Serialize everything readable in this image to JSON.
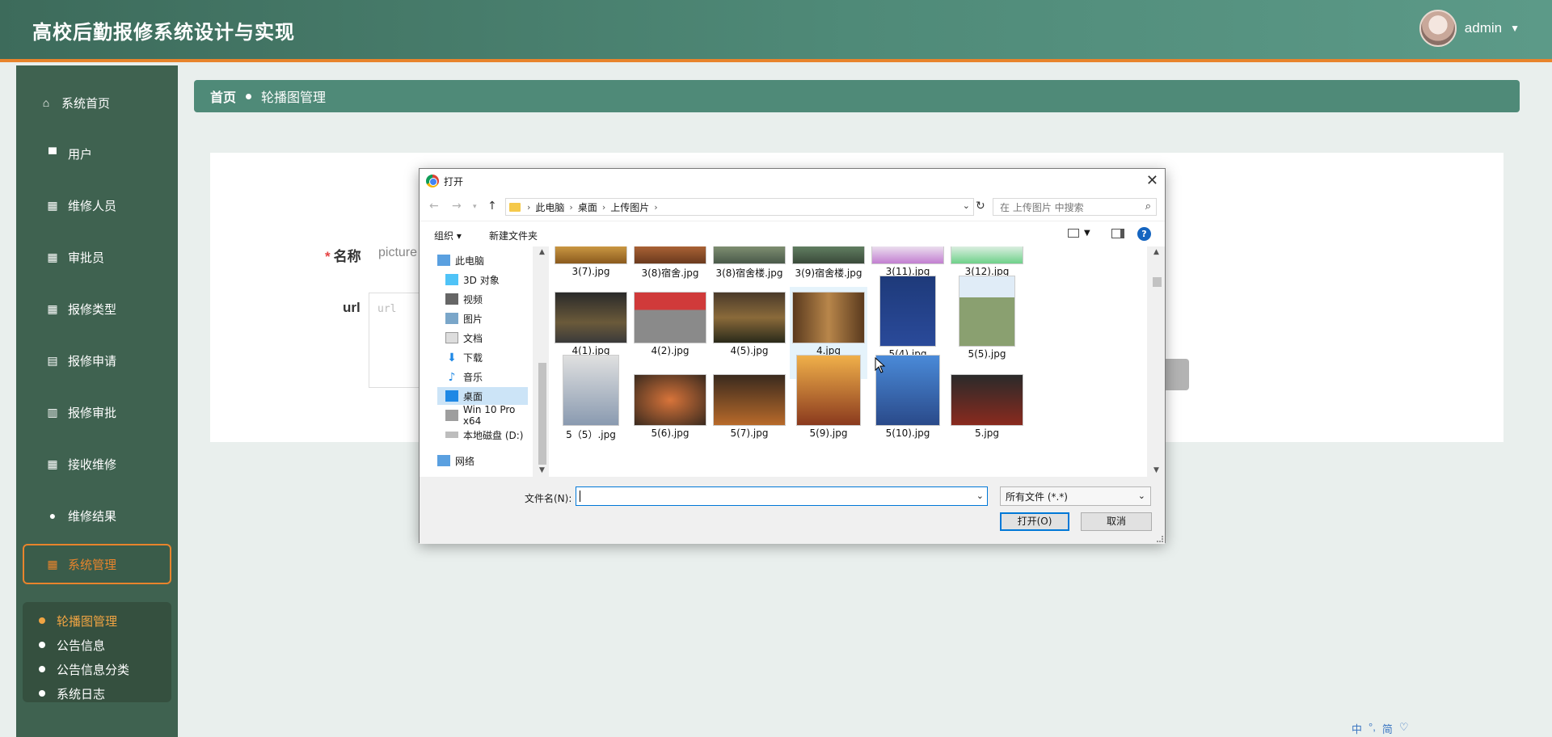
{
  "header": {
    "title": "高校后勤报修系统设计与实现",
    "username": "admin"
  },
  "sidebar": {
    "items": [
      {
        "label": "系统首页",
        "icon": "home-icon"
      },
      {
        "label": "用户",
        "icon": "monitor-icon"
      },
      {
        "label": "维修人员",
        "icon": "grid-icon"
      },
      {
        "label": "审批员",
        "icon": "grid-icon"
      },
      {
        "label": "报修类型",
        "icon": "grid-icon"
      },
      {
        "label": "报修申请",
        "icon": "clipboard-icon"
      },
      {
        "label": "报修审批",
        "icon": "bar-chart-icon"
      },
      {
        "label": "接收维修",
        "icon": "grid-icon"
      },
      {
        "label": "维修结果",
        "icon": "person-icon"
      },
      {
        "label": "系统管理",
        "icon": "grid-icon"
      }
    ],
    "submenu": [
      "轮播图管理",
      "公告信息",
      "公告信息分类",
      "系统日志"
    ]
  },
  "breadcrumb": {
    "home": "首页",
    "current": "轮播图管理"
  },
  "form": {
    "name_label": "名称",
    "name_value": "picture",
    "url_label": "url",
    "url_placeholder": "url"
  },
  "dialog": {
    "title": "打开",
    "path": [
      "此电脑",
      "桌面",
      "上传图片"
    ],
    "search_placeholder": "在 上传图片 中搜索",
    "toolbar": {
      "organize": "组织 ▾",
      "new_folder": "新建文件夹"
    },
    "nav_items": [
      "此电脑",
      "3D 对象",
      "视频",
      "图片",
      "文档",
      "下载",
      "音乐",
      "桌面",
      "Win 10 Pro x64",
      "本地磁盘 (D:)",
      "网络"
    ],
    "files": [
      "3(7).jpg",
      "3(8)宿舍.jpg",
      "3(8)宿舍楼.jpg",
      "3(9)宿舍楼.jpg",
      "3(11).jpg",
      "3(12).jpg",
      "4(1).jpg",
      "4(2).jpg",
      "4(5).jpg",
      "4.jpg",
      "5(4).jpg",
      "5(5).jpg",
      "5（5）.jpg",
      "5(6).jpg",
      "5(7).jpg",
      "5(9).jpg",
      "5(10).jpg",
      "5.jpg"
    ],
    "filename_label": "文件名(N):",
    "filename_value": "",
    "filetype": "所有文件 (*.*)",
    "open_button": "打开(O)",
    "cancel_button": "取消"
  },
  "ime": [
    "中",
    "°,",
    "简",
    "♡"
  ],
  "colors": {
    "header_start": "#3d6b5b",
    "accent_orange": "#e8842c",
    "sidebar_bg": "#3f6250",
    "breadcrumb_bg": "#4f8a78"
  }
}
